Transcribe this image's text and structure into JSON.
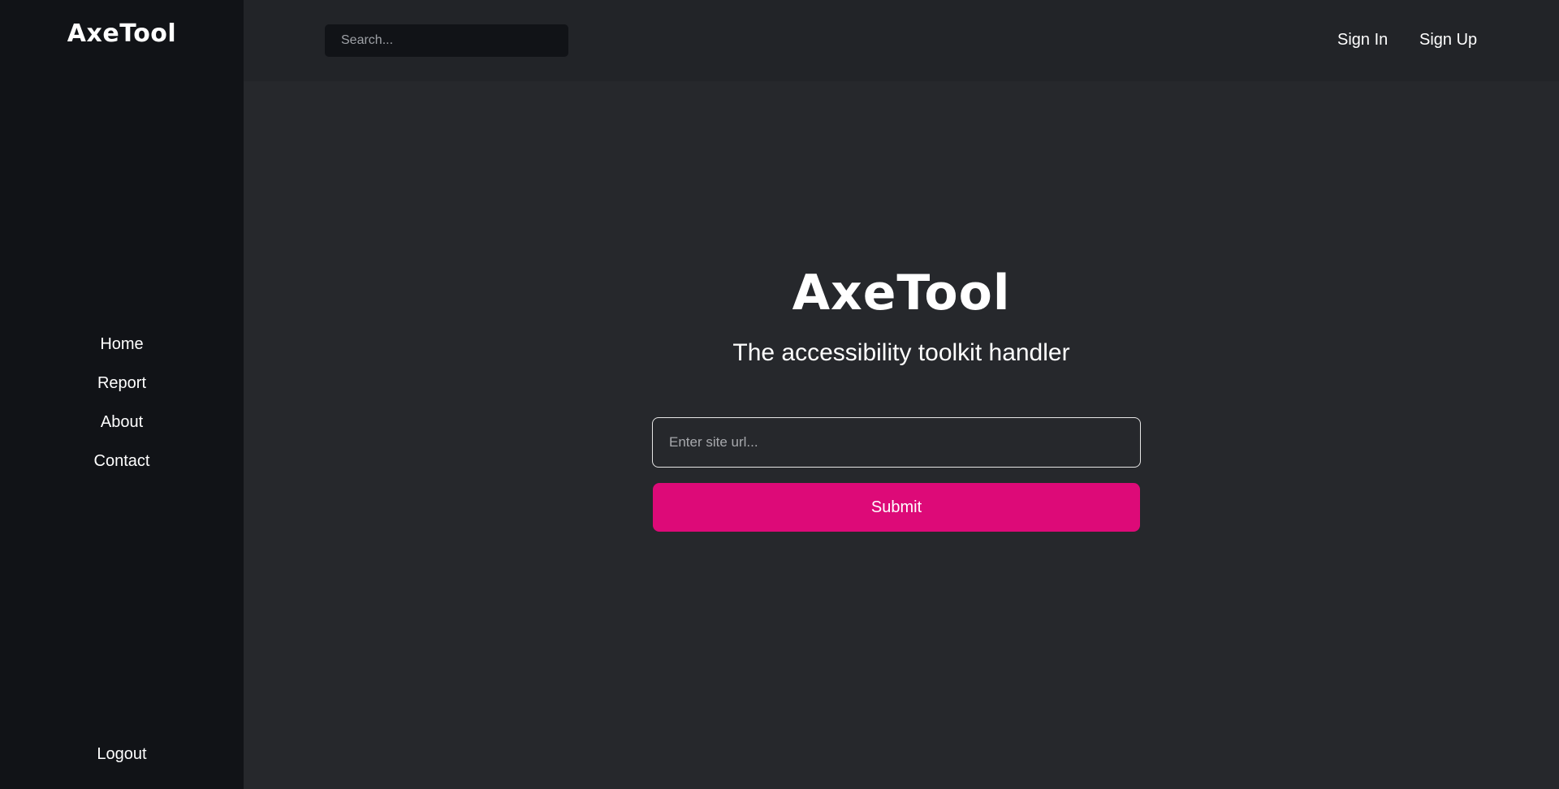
{
  "sidebar": {
    "logo": "AxeTool",
    "items": [
      {
        "label": "Home"
      },
      {
        "label": "Report"
      },
      {
        "label": "About"
      },
      {
        "label": "Contact"
      }
    ],
    "logout": "Logout"
  },
  "header": {
    "search_placeholder": "Search...",
    "sign_in": "Sign In",
    "sign_up": "Sign Up"
  },
  "main": {
    "title": "AxeTool",
    "subtitle": "The accessibility toolkit handler",
    "url_placeholder": "Enter site url...",
    "submit_label": "Submit"
  },
  "colors": {
    "sidebar_bg": "#111317",
    "header_bg": "#222428",
    "page_bg": "#26282c",
    "accent": "#dd0a78"
  }
}
